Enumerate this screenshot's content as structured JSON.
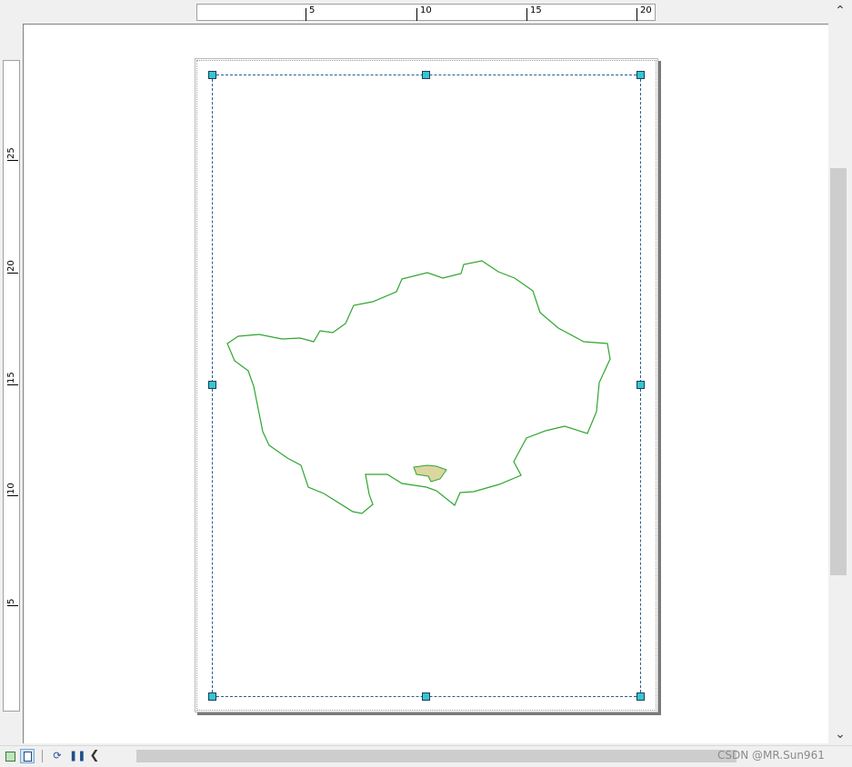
{
  "rulers": {
    "horizontal": [
      {
        "label": "5"
      },
      {
        "label": "10"
      },
      {
        "label": "15"
      },
      {
        "label": "20"
      }
    ],
    "vertical": [
      {
        "label": "25"
      },
      {
        "label": "20"
      },
      {
        "label": "15"
      },
      {
        "label": "10"
      },
      {
        "label": "5"
      }
    ]
  },
  "scrollbar": {
    "up_icon": "chevron-up-icon",
    "down_icon": "chevron-down-icon"
  },
  "toolbar": {
    "data_view_icon": "data-view-icon",
    "layout_view_icon": "layout-view-icon",
    "refresh_icon": "refresh-icon",
    "pause_icon": "pause-icon",
    "scroll_left_icon": "chevron-left-icon"
  },
  "colors": {
    "boundary_stroke": "#2fa52f",
    "highlight_fill": "#dcd6a0",
    "frame_stroke": "#2a5f8a",
    "handle_fill": "#35c6d0"
  },
  "watermark": "CSDN @MR.Sun961"
}
